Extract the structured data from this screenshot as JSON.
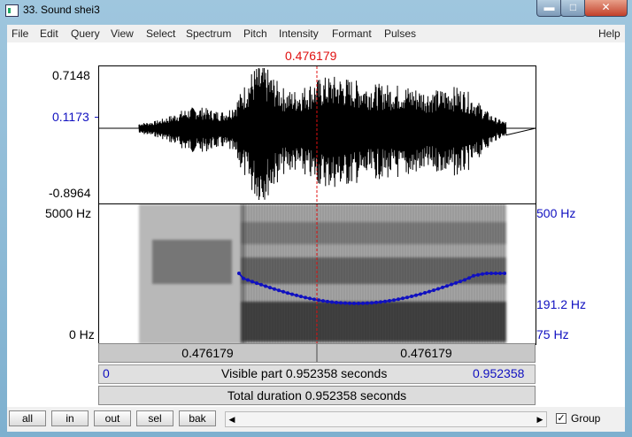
{
  "window": {
    "title": "33. Sound shei3",
    "min_glyph": "▬",
    "max_glyph": "□",
    "close_glyph": "✕"
  },
  "menu": [
    "File",
    "Edit",
    "Query",
    "View",
    "Select",
    "Spectrum",
    "Pitch",
    "Intensity",
    "Formant",
    "Pulses"
  ],
  "help": "Help",
  "cursor_time": "0.476179",
  "wave": {
    "max": "0.7148",
    "cursor_val": "0.1173",
    "min": "-0.8964"
  },
  "spec": {
    "max_freq": "5000 Hz",
    "min_freq": "0 Hz"
  },
  "pitch": {
    "max": "500 Hz",
    "cursor": "191.2 Hz",
    "min": "75 Hz"
  },
  "segments": {
    "left": "0.476179",
    "right": "0.476179"
  },
  "visible": {
    "start": "0",
    "text": "Visible part 0.952358 seconds",
    "end": "0.952358"
  },
  "total": "Total duration 0.952358 seconds",
  "buttons": {
    "all": "all",
    "in": "in",
    "out": "out",
    "sel": "sel",
    "bak": "bak"
  },
  "group": {
    "label": "Group",
    "checked": true
  },
  "colors": {
    "pitch": "#1010c0",
    "cursor": "#e01010"
  }
}
